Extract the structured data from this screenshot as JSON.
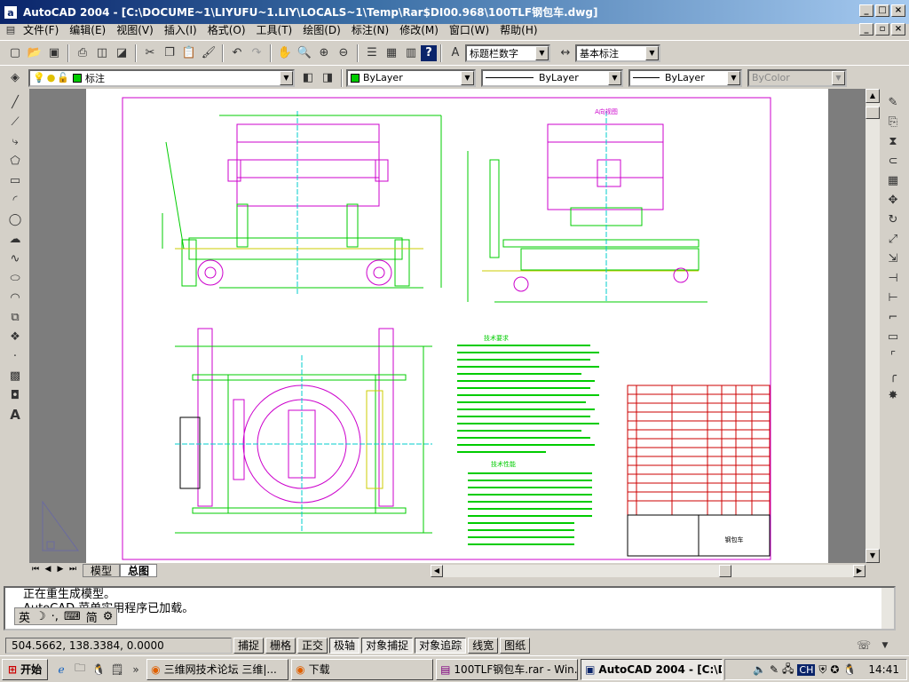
{
  "window": {
    "title": "AutoCAD 2004 - [C:\\DOCUME~1\\LIYUFU~1.LIY\\LOCALS~1\\Temp\\Rar$DI00.968\\100TLF钢包车.dwg]",
    "app_icon": "a"
  },
  "menu": [
    "文件(F)",
    "编辑(E)",
    "视图(V)",
    "插入(I)",
    "格式(O)",
    "工具(T)",
    "绘图(D)",
    "标注(N)",
    "修改(M)",
    "窗口(W)",
    "帮助(H)"
  ],
  "toolbar1": {
    "text_style": "标题栏数字",
    "dim_style": "基本标注"
  },
  "toolbar2": {
    "layer": "标注",
    "color": "ByLayer",
    "linetype": "ByLayer",
    "lineweight": "ByLayer",
    "plotstyle": "ByColor"
  },
  "tabs": [
    "模型",
    "总图"
  ],
  "active_tab": "总图",
  "command_lines": [
    "正在重生成模型。",
    "AutoCAD 菜单实用程序已加载。"
  ],
  "ime": {
    "lang": "英",
    "mode": "简"
  },
  "status": {
    "coords": "504.5662,  138.3384,  0.0000",
    "buttons": [
      {
        "label": "捕捉",
        "on": false
      },
      {
        "label": "栅格",
        "on": false
      },
      {
        "label": "正交",
        "on": false
      },
      {
        "label": "极轴",
        "on": true
      },
      {
        "label": "对象捕捉",
        "on": true
      },
      {
        "label": "对象追踪",
        "on": true
      },
      {
        "label": "线宽",
        "on": false
      },
      {
        "label": "图纸",
        "on": false
      }
    ]
  },
  "taskbar": {
    "start": "开始",
    "tasks": [
      "三维网技术论坛 三维|...",
      "下载",
      "100TLF钢包车.rar - Win...",
      "AutoCAD 2004 - [C:\\DO..."
    ],
    "active_task": 3,
    "clock": "14:41",
    "tray_lang": "CH"
  },
  "drawing": {
    "title_block_name": "钢包车",
    "notes_title": "技术要求",
    "perf_title": "技术性能",
    "side_view_label": "A向视图"
  },
  "colors": {
    "titlebar_start": "#0a246a",
    "paper_border": "#cc00cc",
    "geom_green": "#00cc00",
    "geom_magenta": "#cc00cc",
    "geom_cyan": "#00cccc",
    "geom_yellow": "#cccc00",
    "title_block_red": "#cc0000"
  }
}
